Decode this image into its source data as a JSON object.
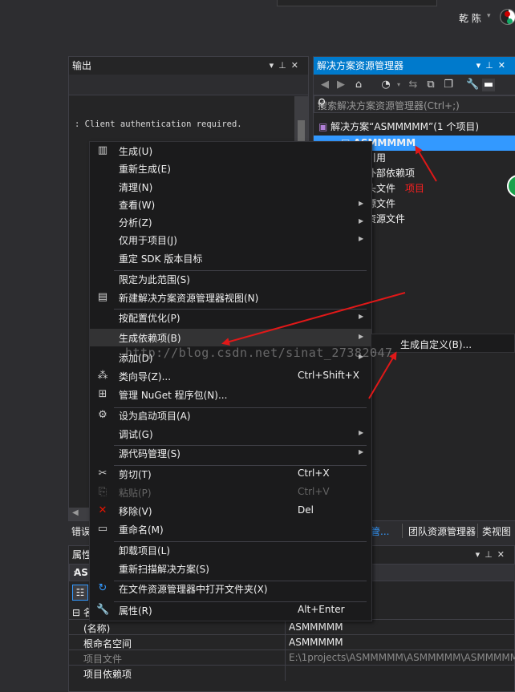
{
  "topbar": {
    "user_name": "乾 陈",
    "user_menu_arrow": "▾",
    "search_partial": "",
    "top_partial": ""
  },
  "output": {
    "title": "输出",
    "text": ": Client authentication required."
  },
  "solution_explorer": {
    "title": "解决方案资源管理器",
    "search_placeholder": "搜索解决方案资源管理器(Ctrl+;)",
    "solution_label": "解决方案“ASMMMMM”(1 个项目)",
    "project_label": "ASMMMMM",
    "items": [
      "引用",
      "外部依赖项",
      "头文件",
      "源文件",
      "资源文件"
    ],
    "annotation": "项目"
  },
  "bottom_tabs": {
    "left_tab": "错误",
    "link_tab": "管...",
    "team_tab": "团队资源管理器",
    "class_tab": "类视图"
  },
  "properties": {
    "title": "属性",
    "object": "ASM",
    "category": "名",
    "rows": [
      {
        "key": "(名称)",
        "value": "ASMMMMM",
        "dim": false
      },
      {
        "key": "根命名空间",
        "value": "ASMMMMM",
        "dim": false
      },
      {
        "key": "项目文件",
        "value": "E:\\1projects\\ASMMMMM\\ASMMMMM\\ASMMMMM",
        "dim": true
      },
      {
        "key": "项目依赖项",
        "value": "",
        "dim": false
      }
    ]
  },
  "context_menu": {
    "items": [
      {
        "label": "生成(U)",
        "icon": "build-icon",
        "glyph": "▥"
      },
      {
        "label": "重新生成(E)"
      },
      {
        "label": "清理(N)"
      },
      {
        "label": "查看(W)",
        "submenu": true
      },
      {
        "label": "分析(Z)",
        "submenu": true
      },
      {
        "label": "仅用于项目(J)",
        "submenu": true
      },
      {
        "label": "重定 SDK 版本目标"
      },
      {
        "label": "限定为此范围(S)"
      },
      {
        "label": "新建解决方案资源管理器视图(N)",
        "icon": "new-view-icon",
        "glyph": "▤"
      },
      {
        "label": "按配置优化(P)",
        "submenu": true
      },
      {
        "label": "生成依赖项(B)",
        "submenu": true,
        "highlight": true
      },
      {
        "label": "添加(D)",
        "submenu": true
      },
      {
        "label": "类向导(Z)...",
        "shortcut": "Ctrl+Shift+X",
        "icon": "class-wizard-icon",
        "glyph": "⁂"
      },
      {
        "label": "管理 NuGet 程序包(N)...",
        "icon": "nuget-icon",
        "glyph": "⊞"
      },
      {
        "label": "设为启动项目(A)",
        "icon": "gear-icon",
        "glyph": "⚙"
      },
      {
        "label": "调试(G)",
        "submenu": true
      },
      {
        "label": "源代码管理(S)",
        "submenu": true
      },
      {
        "label": "剪切(T)",
        "shortcut": "Ctrl+X",
        "icon": "scissors-icon",
        "glyph": "✂"
      },
      {
        "label": "粘贴(P)",
        "shortcut": "Ctrl+V",
        "icon": "paste-icon",
        "glyph": "⎘",
        "disabled": true
      },
      {
        "label": "移除(V)",
        "shortcut": "Del",
        "icon": "remove-icon",
        "glyph": "✕",
        "color": "#e51400"
      },
      {
        "label": "重命名(M)",
        "icon": "rename-icon",
        "glyph": "▭"
      },
      {
        "label": "卸载项目(L)"
      },
      {
        "label": "重新扫描解决方案(S)"
      },
      {
        "label": "在文件资源管理器中打开文件夹(X)",
        "icon": "refresh-icon",
        "glyph": "↻",
        "color": "#3399ff"
      },
      {
        "label": "属性(R)",
        "shortcut": "Alt+Enter",
        "icon": "wrench-icon",
        "glyph": "🔧"
      }
    ]
  },
  "submenu": {
    "label": "生成自定义(B)..."
  },
  "watermark": "http://blog.csdn.net/sinat_27382047",
  "colors": {
    "accent": "#007acc",
    "selection": "#3399ff",
    "arrow": "#e01818"
  }
}
